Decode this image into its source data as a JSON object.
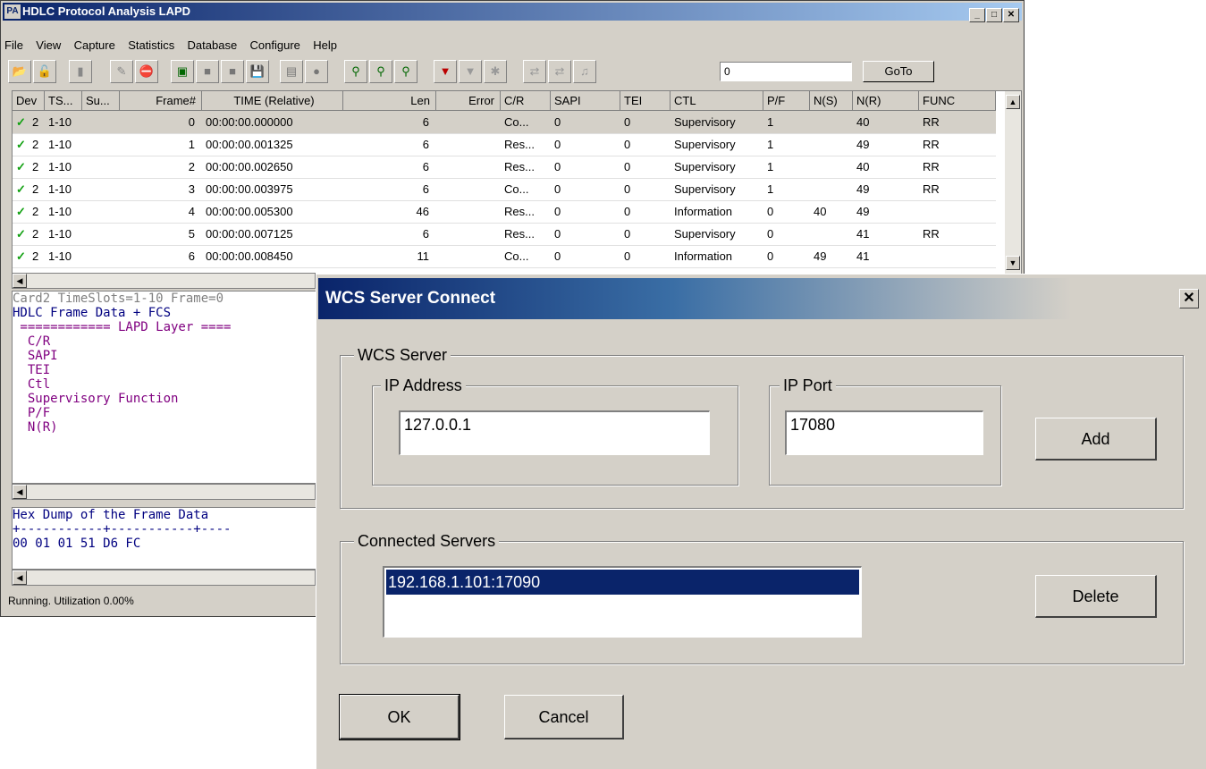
{
  "main_window": {
    "title": "HDLC Protocol Analysis LAPD",
    "app_icon_text": "PA",
    "menu": [
      "File",
      "View",
      "Capture",
      "Statistics",
      "Database",
      "Configure",
      "Help"
    ],
    "goto_value": "0",
    "goto_label": "GoTo",
    "columns": [
      "Dev",
      "TS...",
      "Su...",
      "Frame#",
      "TIME (Relative)",
      "Len",
      "Error",
      "C/R",
      "SAPI",
      "TEI",
      "CTL",
      "P/F",
      "N(S)",
      "N(R)",
      "FUNC"
    ],
    "rows": [
      {
        "dev": "2",
        "ts": "1-10",
        "su": "",
        "frame": "0",
        "time": "00:00:00.000000",
        "len": "6",
        "error": "",
        "cr": "Co...",
        "sapi": "0",
        "tei": "0",
        "ctl": "Supervisory",
        "pf": "1",
        "ns": "",
        "nr": "40",
        "func": "RR"
      },
      {
        "dev": "2",
        "ts": "1-10",
        "su": "",
        "frame": "1",
        "time": "00:00:00.001325",
        "len": "6",
        "error": "",
        "cr": "Res...",
        "sapi": "0",
        "tei": "0",
        "ctl": "Supervisory",
        "pf": "1",
        "ns": "",
        "nr": "49",
        "func": "RR"
      },
      {
        "dev": "2",
        "ts": "1-10",
        "su": "",
        "frame": "2",
        "time": "00:00:00.002650",
        "len": "6",
        "error": "",
        "cr": "Res...",
        "sapi": "0",
        "tei": "0",
        "ctl": "Supervisory",
        "pf": "1",
        "ns": "",
        "nr": "40",
        "func": "RR"
      },
      {
        "dev": "2",
        "ts": "1-10",
        "su": "",
        "frame": "3",
        "time": "00:00:00.003975",
        "len": "6",
        "error": "",
        "cr": "Co...",
        "sapi": "0",
        "tei": "0",
        "ctl": "Supervisory",
        "pf": "1",
        "ns": "",
        "nr": "49",
        "func": "RR"
      },
      {
        "dev": "2",
        "ts": "1-10",
        "su": "",
        "frame": "4",
        "time": "00:00:00.005300",
        "len": "46",
        "error": "",
        "cr": "Res...",
        "sapi": "0",
        "tei": "0",
        "ctl": "Information",
        "pf": "0",
        "ns": "40",
        "nr": "49",
        "func": ""
      },
      {
        "dev": "2",
        "ts": "1-10",
        "su": "",
        "frame": "5",
        "time": "00:00:00.007125",
        "len": "6",
        "error": "",
        "cr": "Res...",
        "sapi": "0",
        "tei": "0",
        "ctl": "Supervisory",
        "pf": "0",
        "ns": "",
        "nr": "41",
        "func": "RR"
      },
      {
        "dev": "2",
        "ts": "1-10",
        "su": "",
        "frame": "6",
        "time": "00:00:00.008450",
        "len": "11",
        "error": "",
        "cr": "Co...",
        "sapi": "0",
        "tei": "0",
        "ctl": "Information",
        "pf": "0",
        "ns": "49",
        "nr": "41",
        "func": ""
      }
    ],
    "decode_lines": [
      "Card2 TimeSlots=1-10 Frame=0",
      "HDLC Frame Data + FCS",
      " ============ LAPD Layer ====",
      "  C/R",
      "  SAPI",
      "  TEI",
      "  Ctl",
      "  Supervisory Function",
      "  P/F",
      "  N(R)"
    ],
    "hex_lines": [
      "Hex Dump of the Frame Data",
      "+-----------+-----------+----",
      "00 01 01 51 D6 FC"
    ],
    "status": "Running. Utilization 0.00%"
  },
  "dialog": {
    "title": "WCS Server Connect",
    "wcs_server_label": "WCS Server",
    "ip_address_label": "IP Address",
    "ip_address_value": "127.0.0.1",
    "ip_port_label": "IP Port",
    "ip_port_value": "17080",
    "add_label": "Add",
    "connected_label": "Connected Servers",
    "connected_servers": [
      "192.168.1.101:17090"
    ],
    "delete_label": "Delete",
    "ok_label": "OK",
    "cancel_label": "Cancel"
  },
  "colors": {
    "titlebar": "#0a246a",
    "selection": "#0a246a",
    "check": "#10a010",
    "decode_text": "#800080"
  }
}
